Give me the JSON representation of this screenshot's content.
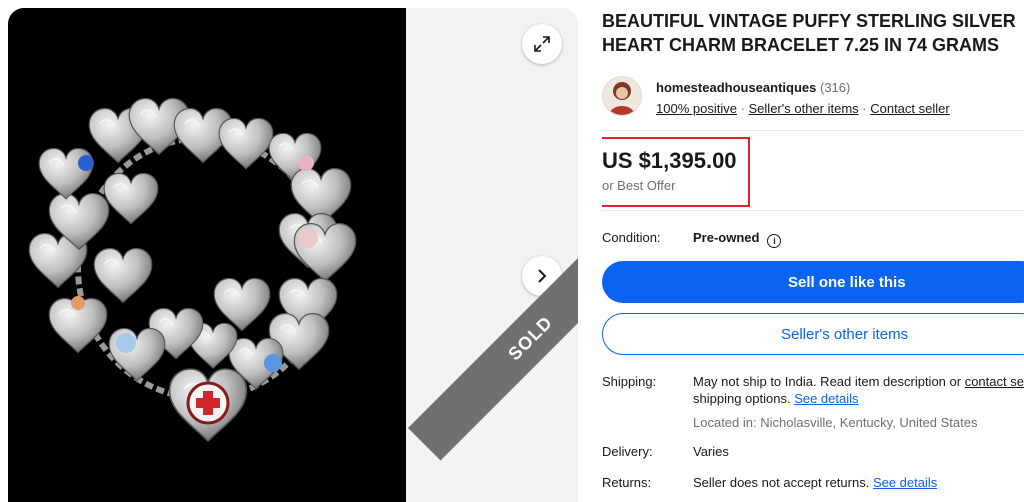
{
  "gallery": {
    "expand_icon": "expand-icon",
    "next_icon": "chevron-right-icon",
    "sold_label": "SOLD"
  },
  "item": {
    "title_line1": "BEAUTIFUL VINTAGE PUFFY STERLING SILVER",
    "title_line2": "HEART CHARM BRACELET 7.25 IN 74 GRAMS"
  },
  "seller": {
    "name": "homesteadhouseantiques",
    "feedback_count": "(316)",
    "positive": "100% positive",
    "sep1": " · ",
    "other_items": "Seller's other items",
    "sep2": " · ",
    "contact": "Contact seller"
  },
  "price": {
    "amount": "US $1,395.00",
    "best_offer": "or Best Offer"
  },
  "condition": {
    "label": "Condition:",
    "value": "Pre-owned",
    "info_icon": "info-icon"
  },
  "actions": {
    "sell_one": "Sell one like this",
    "other_items": "Seller's other items"
  },
  "shipping": {
    "label": "Shipping:",
    "line1": "May not ship to India. Read item description or ",
    "line1_link": "contact seller",
    "line2": "shipping options. ",
    "line2_link": "See details",
    "location": "Located in: Nicholasville, Kentucky, United States"
  },
  "delivery": {
    "label": "Delivery:",
    "value": "Varies"
  },
  "returns": {
    "label": "Returns:",
    "value": "Seller does not accept returns. ",
    "link": "See details"
  },
  "colors": {
    "primary_blue": "#0a64f0",
    "highlight_red": "#e4212b",
    "sold_gray": "#707070"
  }
}
